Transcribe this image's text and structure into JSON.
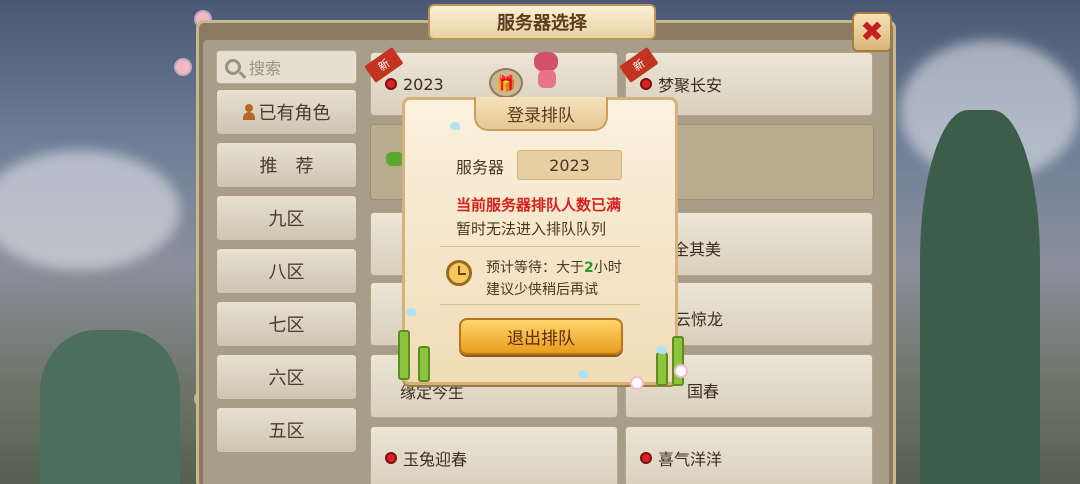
{
  "window": {
    "title": "服务器选择",
    "close_icon": "✖"
  },
  "sidebar": {
    "search_placeholder": "搜索",
    "items": [
      {
        "label": "已有角色"
      },
      {
        "label": "推　荐"
      },
      {
        "label": "九区"
      },
      {
        "label": "八区"
      },
      {
        "label": "七区"
      },
      {
        "label": "六区"
      },
      {
        "label": "五区"
      }
    ]
  },
  "servers": {
    "new_badge": "新",
    "row1": [
      {
        "name": "2023",
        "is_new": true
      },
      {
        "name": "梦聚长安",
        "is_new": true
      }
    ],
    "partial_names": [
      "全其美",
      "云惊龙",
      "缘定今生",
      "国春",
      "玉兔迎春",
      "喜气洋洋"
    ]
  },
  "dialog": {
    "title": "登录排队",
    "server_label": "服务器",
    "server_value": "2023",
    "warning": "当前服务器排队人数已满",
    "info": "暂时无法进入排队队列",
    "wait_prefix": "预计等待：大于",
    "wait_number": "2",
    "wait_suffix": "小时",
    "suggestion": "建议少侠稍后再试",
    "exit_button": "退出排队"
  },
  "colors": {
    "warning": "#d62020",
    "wait_number": "#2c9b26",
    "accent": "#e99c1f",
    "close": "#c41f1f"
  }
}
